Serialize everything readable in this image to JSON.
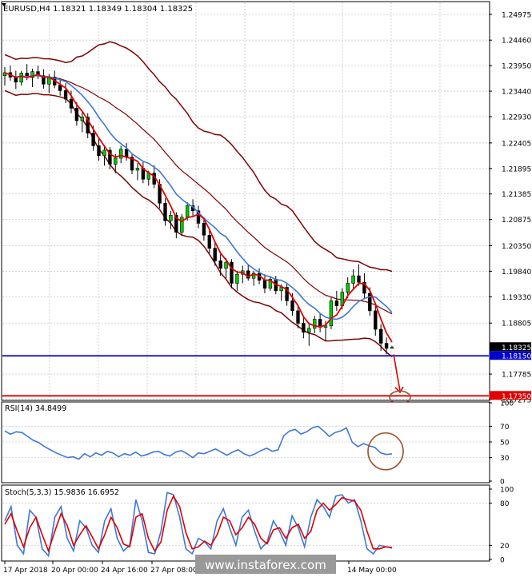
{
  "chart_data": {
    "type": "candlestick",
    "symbol_header": "EURUSD,H4  1.18321 1.18349 1.18304 1.18325",
    "price_axis": {
      "ticks": [
        1.24975,
        1.2446,
        1.2395,
        1.2344,
        1.2293,
        1.22405,
        1.21895,
        1.21385,
        1.20875,
        1.2035,
        1.1984,
        1.1933,
        1.18805,
        1.17785,
        1.17275
      ],
      "tick_labels": [
        "1.24975",
        "1.24460",
        "1.23950",
        "1.23440",
        "1.22930",
        "1.22405",
        "1.21895",
        "1.21385",
        "1.20875",
        "1.20350",
        "1.19840",
        "1.19330",
        "1.18805",
        "1.17785",
        "1.17275"
      ],
      "range": [
        1.17275,
        1.2523
      ]
    },
    "price_tags": [
      {
        "label": "1.18325",
        "value": 1.18325,
        "style": "current",
        "color": "#000000"
      },
      {
        "label": "1.18150",
        "value": 1.1815,
        "style": "level",
        "color": "#0000cc"
      },
      {
        "label": "1.17350",
        "value": 1.1735,
        "style": "level",
        "color": "#e00000"
      }
    ],
    "horizontal_levels": [
      {
        "value": 1.1815,
        "color": "#0000cc"
      },
      {
        "value": 1.1735,
        "color": "#e00000"
      }
    ],
    "time_labels": [
      "17 Apr 2018",
      "20 Apr 00:00",
      "24 Apr 16:00",
      "27 Apr 08:00",
      "14 May 00:00"
    ],
    "candles": [
      [
        1.2375,
        1.2392,
        1.2355,
        1.2381
      ],
      [
        1.2381,
        1.2395,
        1.2365,
        1.2372
      ],
      [
        1.2372,
        1.2385,
        1.2348,
        1.2362
      ],
      [
        1.2362,
        1.2384,
        1.2355,
        1.238
      ],
      [
        1.238,
        1.2398,
        1.2366,
        1.2371
      ],
      [
        1.2371,
        1.2389,
        1.2352,
        1.2383
      ],
      [
        1.2383,
        1.2395,
        1.2368,
        1.2375
      ],
      [
        1.2375,
        1.2388,
        1.2349,
        1.2358
      ],
      [
        1.2358,
        1.2378,
        1.234,
        1.2372
      ],
      [
        1.2372,
        1.2385,
        1.235,
        1.2356
      ],
      [
        1.2356,
        1.237,
        1.2335,
        1.2345
      ],
      [
        1.2345,
        1.236,
        1.232,
        1.2328
      ],
      [
        1.2328,
        1.2345,
        1.23,
        1.231
      ],
      [
        1.231,
        1.2322,
        1.2275,
        1.2285
      ],
      [
        1.2285,
        1.2302,
        1.2262,
        1.2292
      ],
      [
        1.2292,
        1.23,
        1.225,
        1.226
      ],
      [
        1.226,
        1.2275,
        1.2225,
        1.2235
      ],
      [
        1.2235,
        1.225,
        1.2205,
        1.2215
      ],
      [
        1.2215,
        1.2235,
        1.2195,
        1.2226
      ],
      [
        1.2226,
        1.2232,
        1.2188,
        1.2198
      ],
      [
        1.2198,
        1.2218,
        1.218,
        1.221
      ],
      [
        1.221,
        1.2235,
        1.22,
        1.2228
      ],
      [
        1.2228,
        1.224,
        1.2205,
        1.2212
      ],
      [
        1.2212,
        1.222,
        1.2178,
        1.2186
      ],
      [
        1.2186,
        1.22,
        1.2166,
        1.219
      ],
      [
        1.219,
        1.2202,
        1.216,
        1.2168
      ],
      [
        1.2168,
        1.2185,
        1.2155,
        1.218
      ],
      [
        1.218,
        1.2196,
        1.215,
        1.2158
      ],
      [
        1.2158,
        1.2168,
        1.211,
        1.212
      ],
      [
        1.212,
        1.213,
        1.2075,
        1.2085
      ],
      [
        1.2085,
        1.2105,
        1.2068,
        1.2096
      ],
      [
        1.2096,
        1.2102,
        1.205,
        1.2062
      ],
      [
        1.2062,
        1.2098,
        1.2055,
        1.2092
      ],
      [
        1.2092,
        1.2122,
        1.2085,
        1.2115
      ],
      [
        1.2115,
        1.2128,
        1.2095,
        1.2105
      ],
      [
        1.2105,
        1.2115,
        1.207,
        1.208
      ],
      [
        1.208,
        1.2092,
        1.2045,
        1.2056
      ],
      [
        1.2056,
        1.2068,
        1.202,
        1.203
      ],
      [
        1.203,
        1.2042,
        1.1995,
        1.2005
      ],
      [
        1.2005,
        1.2018,
        1.1975,
        1.199
      ],
      [
        1.199,
        1.201,
        1.197,
        1.2002
      ],
      [
        1.2002,
        1.2008,
        1.195,
        1.196
      ],
      [
        1.196,
        1.1985,
        1.1945,
        1.1978
      ],
      [
        1.1978,
        1.1995,
        1.196,
        1.1985
      ],
      [
        1.1985,
        1.1998,
        1.1965,
        1.197
      ],
      [
        1.197,
        1.1985,
        1.1955,
        1.198
      ],
      [
        1.198,
        1.199,
        1.1958,
        1.1966
      ],
      [
        1.1966,
        1.1978,
        1.194,
        1.195
      ],
      [
        1.195,
        1.1972,
        1.1945,
        1.1968
      ],
      [
        1.1968,
        1.1975,
        1.1938,
        1.1945
      ],
      [
        1.1945,
        1.1958,
        1.1925,
        1.1952
      ],
      [
        1.1952,
        1.196,
        1.1915,
        1.1925
      ],
      [
        1.1925,
        1.194,
        1.1895,
        1.1905
      ],
      [
        1.1905,
        1.1918,
        1.187,
        1.188
      ],
      [
        1.188,
        1.1892,
        1.185,
        1.1862
      ],
      [
        1.1862,
        1.188,
        1.1835,
        1.187
      ],
      [
        1.187,
        1.1895,
        1.186,
        1.1888
      ],
      [
        1.1888,
        1.19,
        1.1862,
        1.1872
      ],
      [
        1.1872,
        1.1885,
        1.1845,
        1.1875
      ],
      [
        1.1875,
        1.1932,
        1.1868,
        1.1925
      ],
      [
        1.1925,
        1.1945,
        1.1905,
        1.1915
      ],
      [
        1.1915,
        1.195,
        1.1908,
        1.1942
      ],
      [
        1.1942,
        1.1972,
        1.193,
        1.196
      ],
      [
        1.196,
        1.1988,
        1.1948,
        1.1975
      ],
      [
        1.1975,
        1.1998,
        1.1955,
        1.1962
      ],
      [
        1.1962,
        1.198,
        1.193,
        1.194
      ],
      [
        1.194,
        1.1952,
        1.1895,
        1.1905
      ],
      [
        1.1905,
        1.1915,
        1.1855,
        1.1868
      ],
      [
        1.1868,
        1.1878,
        1.1825,
        1.184
      ],
      [
        1.184,
        1.1852,
        1.1818,
        1.183
      ],
      [
        1.183,
        1.1835,
        1.183,
        1.1832
      ]
    ],
    "indicators_main": [
      "Bollinger Bands (maroon)",
      "Moving average (red)",
      "Moving average (blue)"
    ],
    "rsi": {
      "label": "RSI(14) 34.8499",
      "levels": [
        70,
        50,
        30
      ],
      "ticks": [
        100,
        70,
        50,
        30,
        0
      ],
      "tick_labels": [
        "100",
        "70",
        "50",
        "30",
        "0"
      ],
      "values": [
        64,
        60,
        63,
        62,
        57,
        52,
        49,
        44,
        40,
        36,
        33,
        30,
        31,
        28,
        35,
        31,
        36,
        33,
        38,
        36,
        31,
        35,
        33,
        37,
        32,
        34,
        37,
        38,
        34,
        32,
        37,
        39,
        35,
        30,
        36,
        35,
        38,
        41,
        37,
        33,
        37,
        40,
        35,
        32,
        35,
        39,
        42,
        38,
        40,
        58,
        64,
        66,
        60,
        63,
        68,
        70,
        64,
        57,
        62,
        64,
        68,
        50,
        44,
        48,
        45,
        43,
        36,
        34,
        34.8
      ]
    },
    "stoch": {
      "label": "Stoch(5,3,3) 15.9836 16.6952",
      "levels": [
        80,
        20
      ],
      "ticks": [
        100,
        80,
        20,
        0
      ],
      "tick_labels": [
        "100",
        "80",
        "20",
        "0"
      ],
      "main": [
        55,
        75,
        20,
        8,
        70,
        60,
        15,
        5,
        60,
        75,
        30,
        12,
        55,
        45,
        20,
        10,
        55,
        72,
        30,
        12,
        20,
        85,
        55,
        10,
        8,
        40,
        95,
        92,
        60,
        15,
        8,
        30,
        25,
        15,
        55,
        72,
        45,
        20,
        60,
        70,
        40,
        15,
        25,
        55,
        40,
        20,
        62,
        45,
        18,
        60,
        85,
        75,
        60,
        90,
        92,
        80,
        85,
        55,
        15,
        8,
        20,
        18,
        16
      ],
      "signal": [
        50,
        65,
        40,
        18,
        45,
        60,
        35,
        12,
        40,
        65,
        48,
        20,
        35,
        48,
        32,
        15,
        35,
        60,
        45,
        22,
        18,
        60,
        65,
        30,
        12,
        25,
        70,
        90,
        75,
        38,
        15,
        18,
        26,
        20,
        35,
        60,
        55,
        35,
        45,
        60,
        50,
        30,
        22,
        42,
        45,
        30,
        45,
        50,
        30,
        40,
        70,
        80,
        70,
        78,
        88,
        85,
        83,
        70,
        40,
        15,
        15,
        18,
        17
      ]
    }
  },
  "watermark": "www.instaforex.com"
}
